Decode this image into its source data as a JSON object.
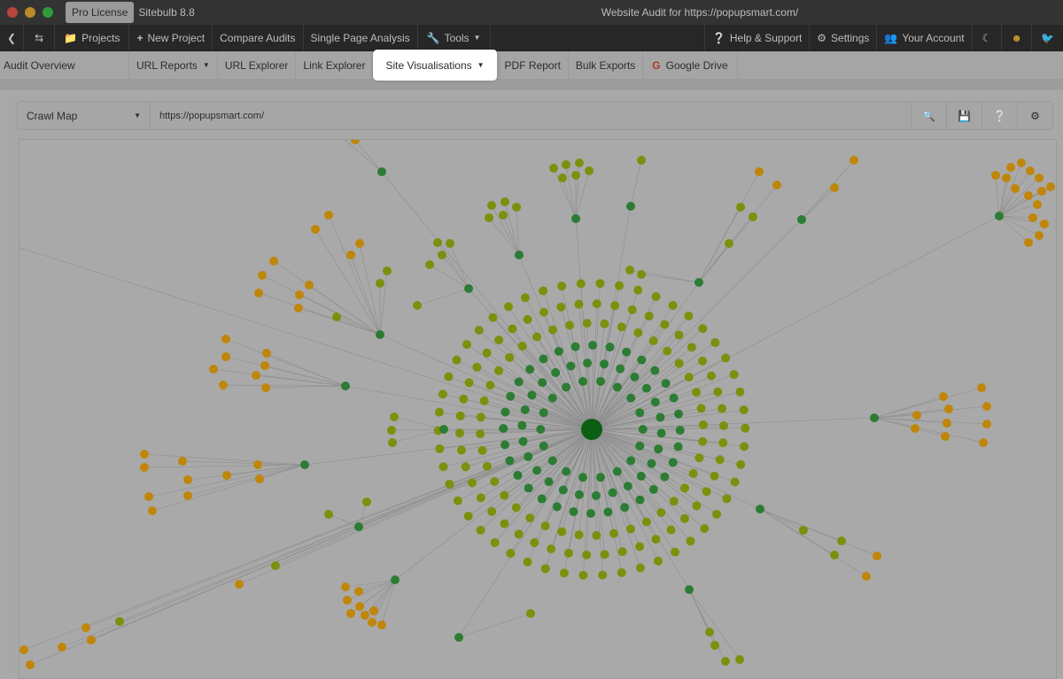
{
  "window": {
    "license": "Pro License",
    "app_version": "Sitebulb 8.8",
    "title": "Website Audit for https://popupsmart.com/",
    "traffic_lights": [
      "#b8443d",
      "#b88a28",
      "#2f9c3a"
    ]
  },
  "nav": {
    "back_icon": "chevron-left-icon",
    "swap_icon": "swap-icon",
    "projects": "Projects",
    "new_project": "New Project",
    "compare": "Compare Audits",
    "single_page": "Single Page Analysis",
    "tools": "Tools",
    "help": "Help & Support",
    "settings": "Settings",
    "account": "Your Account"
  },
  "subnav": {
    "overview": "Audit Overview",
    "url_reports": "URL Reports",
    "url_explorer": "URL Explorer",
    "link_explorer": "Link Explorer",
    "site_vis": "Site Visualisations",
    "pdf": "PDF Report",
    "bulk": "Bulk Exports",
    "gdrive": "Google Drive"
  },
  "toolbar": {
    "view": "Crawl Map",
    "url": "https://popupsmart.com/"
  },
  "crawl_map": {
    "colors": {
      "root": "#0c5e12",
      "level1": "#2c7c34",
      "level2": "#7d8f0d",
      "level3": "#bf8609",
      "link": "#8e8e8e"
    }
  }
}
